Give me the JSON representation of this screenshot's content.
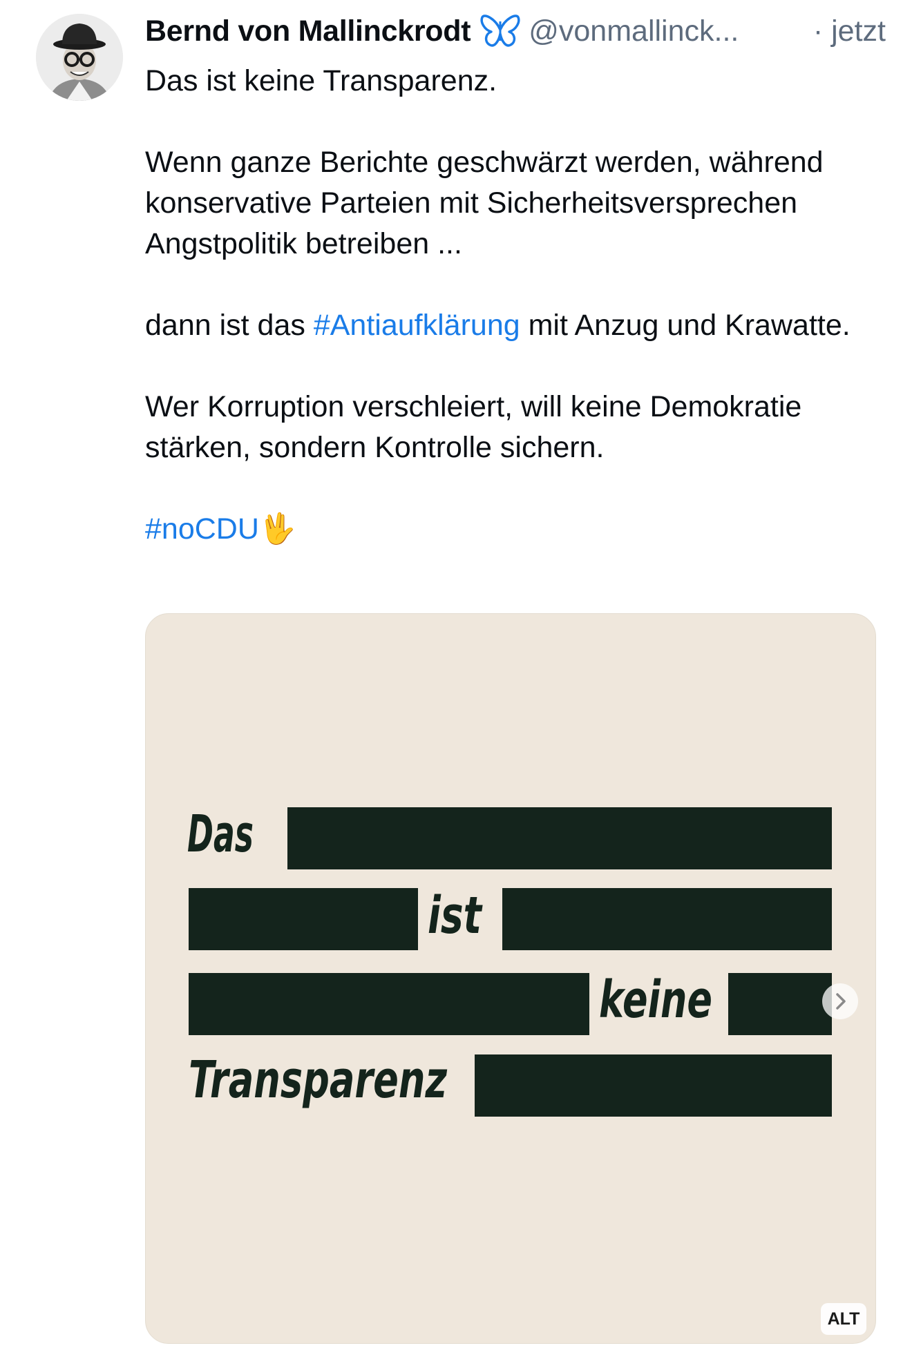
{
  "post": {
    "author_name": "Bernd von Mallinckrodt",
    "author_handle": "@vonmallinck...",
    "time": "· jetzt",
    "line1": "Das ist keine Transparenz.",
    "para2": "Wenn ganze Berichte geschwärzt werden, während konservative Parteien mit Sicherheitsversprechen Angstpolitik betreiben ...",
    "para3_before": "dann ist das ",
    "para3_tag": "#Antiaufklärung",
    "para3_after": " mit Anzug und Krawatte.",
    "para4": "Wer Korruption verschleiert, will keine Demokratie stärken, sondern Kontrolle sichern.",
    "final_tag": "#noCDU",
    "final_emoji": "🖖"
  },
  "media": {
    "words": [
      "Das",
      "ist",
      "keine",
      "Transparenz"
    ],
    "alt_badge": "ALT",
    "background": "#efe7dc",
    "ink": "#14241c"
  },
  "colors": {
    "link": "#1a7ce8",
    "meta": "#5d6b7d",
    "butterfly": "#1a7ce8"
  },
  "icons": {
    "verified": "butterfly-icon",
    "carousel": "chevron-right-icon"
  }
}
